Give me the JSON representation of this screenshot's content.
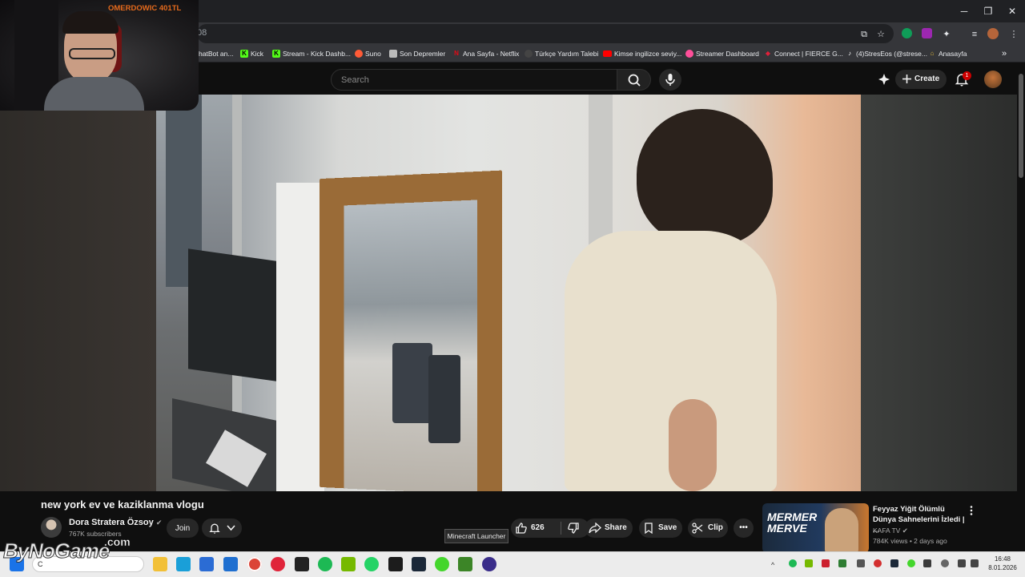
{
  "browser": {
    "address_text": "08",
    "bookmarks": [
      {
        "label": "hatBot an...",
        "icon": "chatbot-icon",
        "color": "#10a37f"
      },
      {
        "label": "Kick",
        "icon": "kick-icon",
        "color": "#53fc18"
      },
      {
        "label": "Stream - Kick Dashb...",
        "icon": "kick-icon",
        "color": "#53fc18"
      },
      {
        "label": "Suno",
        "icon": "suno-icon",
        "color": "#ff5a36"
      },
      {
        "label": "Son Depremler",
        "icon": "page-icon",
        "color": "#bbbbbb"
      },
      {
        "label": "Ana Sayfa - Netflix",
        "icon": "netflix-icon",
        "color": "#e50914"
      },
      {
        "label": "Türkçe Yardım Talebi",
        "icon": "page-icon",
        "color": "#444444"
      },
      {
        "label": "Kimse ingilizce seviy...",
        "icon": "youtube-icon",
        "color": "#ff0000"
      },
      {
        "label": "Streamer Dashboard",
        "icon": "dashboard-icon",
        "color": "#ff4f9a"
      },
      {
        "label": "Connect | FIERCE G...",
        "icon": "fierce-icon",
        "color": "#e0203a"
      },
      {
        "label": "(4)StresEos (@strese...",
        "icon": "tiktok-icon",
        "color": "#111111"
      },
      {
        "label": "Anasayfa",
        "icon": "home-icon",
        "color": "#d9b23a"
      }
    ],
    "more_chevron": "»"
  },
  "youtube": {
    "search_placeholder": "Search",
    "create_label": "Create",
    "notification_count": "1"
  },
  "video": {
    "title": "new york ev ve kaziklanma vlogu",
    "channel_name": "Dora Stratera Özsoy",
    "subscribers": "767K subscribers",
    "join_label": "Join",
    "likes": "626",
    "share_label": "Share",
    "save_label": "Save",
    "clip_label": "Clip"
  },
  "tooltip": "Minecraft Launcher",
  "recommendation": {
    "title": "Feyyaz Yiğit Ölümlü Dünya Sahnelerini İzledi | ...",
    "channel": "KAFA TV",
    "meta": "784K views • 2 days ago",
    "thumb_text_1": "MERMER",
    "thumb_text_2": "MERVE"
  },
  "webcam": {
    "label": "OMERDOWIC 401TL"
  },
  "watermark": {
    "text": "ByNoGame",
    "suffix": ".com"
  },
  "taskbar": {
    "search_text": "C",
    "time": "16:48",
    "date": "8.01.2026",
    "icons": [
      {
        "name": "windows-start-icon",
        "color": "#1a73e8"
      },
      {
        "name": "file-explorer-icon",
        "color": "#f2c037"
      },
      {
        "name": "edge-icon",
        "color": "#1a9fd8"
      },
      {
        "name": "microsoft-store-icon",
        "color": "#2b6cd4"
      },
      {
        "name": "outlook-icon",
        "color": "#1f6fd0"
      },
      {
        "name": "chrome-icon",
        "color": "#db4437"
      },
      {
        "name": "opera-icon",
        "color": "#e0243a"
      },
      {
        "name": "obs-icon",
        "color": "#222222"
      },
      {
        "name": "spotify-icon",
        "color": "#1db954"
      },
      {
        "name": "nvidia-icon",
        "color": "#76b900"
      },
      {
        "name": "whatsapp-icon",
        "color": "#25d366"
      },
      {
        "name": "kick-studio-icon",
        "color": "#1c1c1c"
      },
      {
        "name": "steam-icon",
        "color": "#1b2838"
      },
      {
        "name": "razer-icon",
        "color": "#44d62c"
      },
      {
        "name": "minecraft-launcher-icon",
        "color": "#3c8527"
      },
      {
        "name": "app-icon",
        "color": "#3a2d8a"
      }
    ]
  }
}
